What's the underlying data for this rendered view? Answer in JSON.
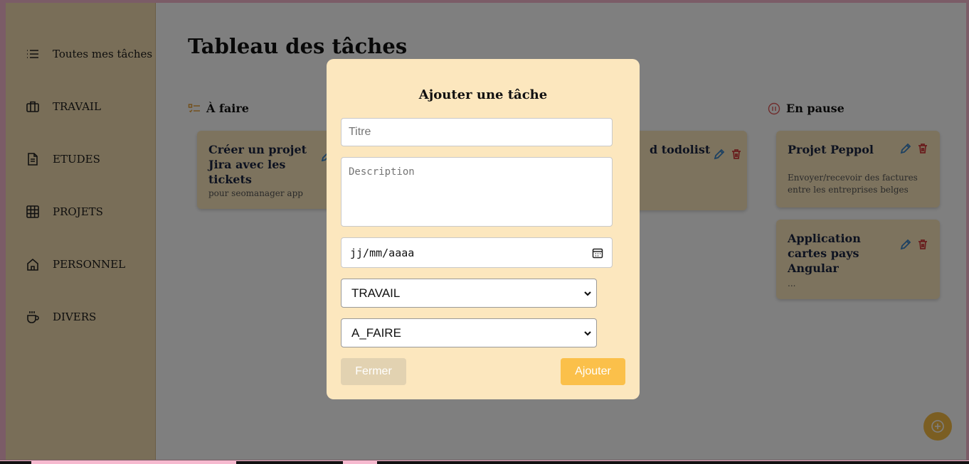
{
  "sidebar": {
    "items": [
      {
        "label": "Toutes mes tâches",
        "icon": "list-icon"
      },
      {
        "label": "TRAVAIL",
        "icon": "briefcase-icon"
      },
      {
        "label": "ETUDES",
        "icon": "document-icon"
      },
      {
        "label": "PROJETS",
        "icon": "grid-icon"
      },
      {
        "label": "PERSONNEL",
        "icon": "home-icon"
      },
      {
        "label": "DIVERS",
        "icon": "coffee-icon"
      }
    ]
  },
  "board": {
    "title": "Tableau des tâches",
    "columns": [
      {
        "title": "À faire",
        "icon": "checklist-icon",
        "color": "#e7a13a"
      },
      {
        "title": "En pause",
        "icon": "pause-circle-icon",
        "color": "#e05a5a"
      }
    ],
    "cards": {
      "todo_1": {
        "title": "Créer un projet Jira avec les tickets",
        "description": "pour seomanager app"
      },
      "middle_1": {
        "title": "d todolist"
      },
      "paused_1": {
        "title": "Projet Peppol",
        "description": "Envoyer/recevoir des factures entre les entreprises belges"
      },
      "paused_2": {
        "title": "Application cartes pays Angular",
        "description": "..."
      }
    }
  },
  "modal": {
    "title": "Ajouter une tâche",
    "title_placeholder": "Titre",
    "description_placeholder": "Description",
    "date_placeholder": "jj/mm/aaaa",
    "category_value": "TRAVAIL",
    "status_value": "A_FAIRE",
    "close_label": "Fermer",
    "add_label": "Ajouter"
  },
  "colors": {
    "sidebar_bg": "#f3ddb0",
    "card_bg": "#fbe7bd",
    "modal_bg": "#fce7be",
    "accent": "#fbc04a",
    "edit_icon": "#3b82c4",
    "delete_icon": "#d33b3b"
  }
}
